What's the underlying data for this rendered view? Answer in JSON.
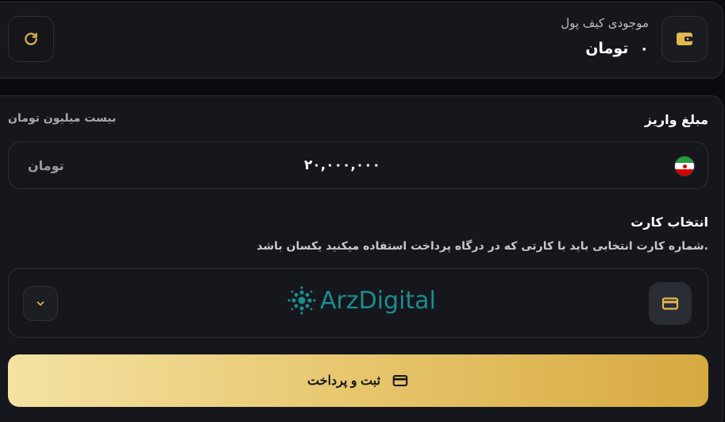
{
  "colors": {
    "accent": "#e2b84f",
    "background": "#0b0c10",
    "card": "#15171c",
    "brand": "#1d8c8e"
  },
  "wallet": {
    "title": "موجودی کیف پول",
    "amount": "۰",
    "currency": "تومان",
    "icon": "wallet-icon",
    "refresh_icon": "refresh-icon"
  },
  "deposit": {
    "title": "مبلغ واریز",
    "hint": "بیست میلیون تومان",
    "value": "۲۰,۰۰۰,۰۰۰",
    "unit": "تومان",
    "flag_icon": "iran-flag-icon"
  },
  "card_select": {
    "title": "انتخاب کارت",
    "description": "شماره کارت انتخابی باید با کارتی که در درگاه پرداخت استفاده میکنید یکسان باشد.",
    "brand": "ArzDigital",
    "card_icon": "credit-card-icon",
    "chevron_icon": "chevron-down-icon"
  },
  "submit": {
    "label": "ثبت و پرداخت",
    "icon": "credit-card-icon"
  }
}
